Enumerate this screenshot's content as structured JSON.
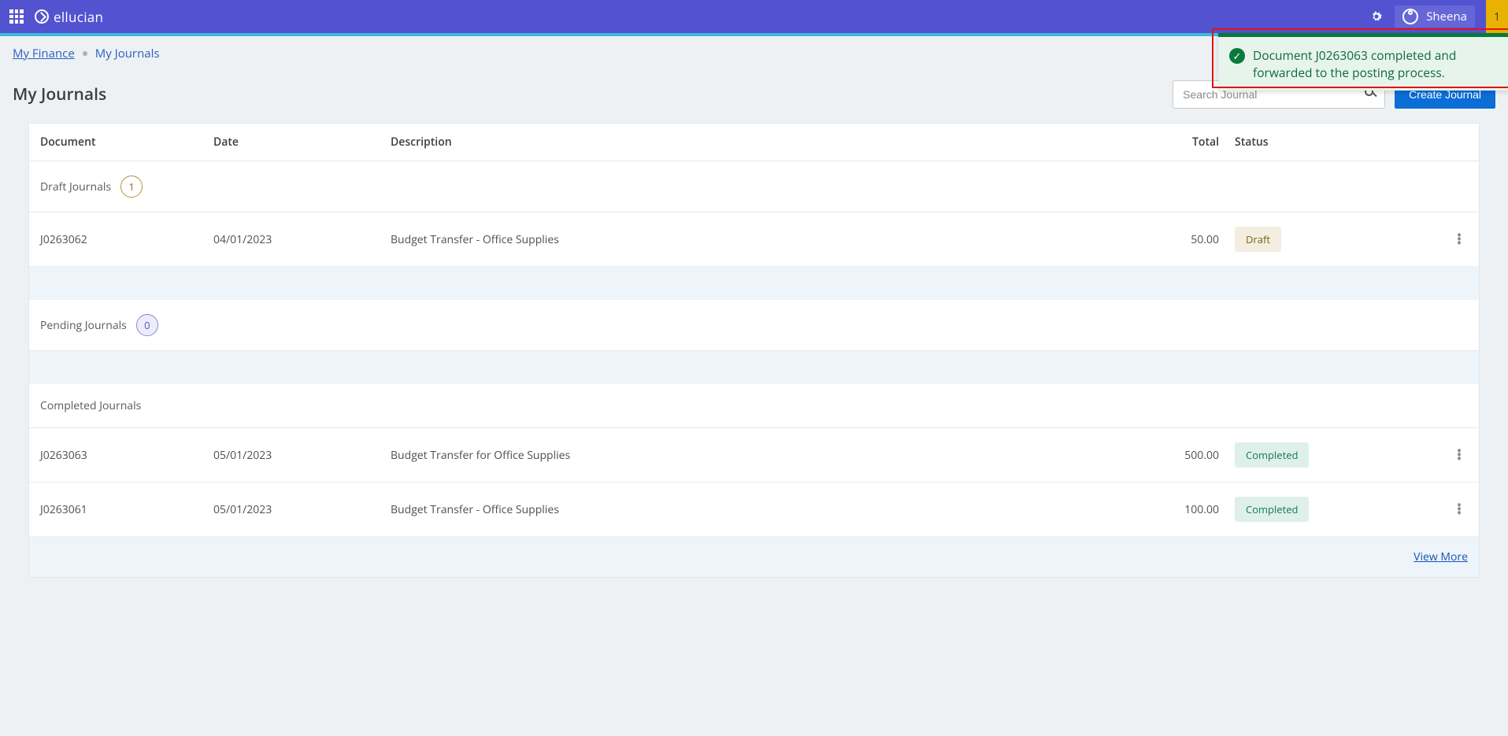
{
  "appbar": {
    "brand": "ellucian",
    "user_name": "Sheena",
    "notification_count": "1"
  },
  "breadcrumb": {
    "root": "My Finance",
    "current": "My Journals"
  },
  "page": {
    "title": "My Journals",
    "search_placeholder": "Search Journal",
    "create_button": "Create Journal"
  },
  "columns": {
    "document": "Document",
    "date": "Date",
    "description": "Description",
    "total": "Total",
    "status": "Status"
  },
  "sections": {
    "draft": {
      "label": "Draft Journals",
      "count": "1"
    },
    "pending": {
      "label": "Pending Journals",
      "count": "0"
    },
    "completed": {
      "label": "Completed Journals"
    }
  },
  "status_labels": {
    "draft": "Draft",
    "completed": "Completed"
  },
  "draft_rows": [
    {
      "document": "J0263062",
      "date": "04/01/2023",
      "description": "Budget Transfer - Office Supplies",
      "total": "50.00"
    }
  ],
  "completed_rows": [
    {
      "document": "J0263063",
      "date": "05/01/2023",
      "description": "Budget Transfer for Office Supplies",
      "total": "500.00"
    },
    {
      "document": "J0263061",
      "date": "05/01/2023",
      "description": "Budget Transfer - Office Supplies",
      "total": "100.00"
    }
  ],
  "footer": {
    "view_more": "View More"
  },
  "toast": {
    "message": "Document J0263063 completed and forwarded to the posting process."
  }
}
